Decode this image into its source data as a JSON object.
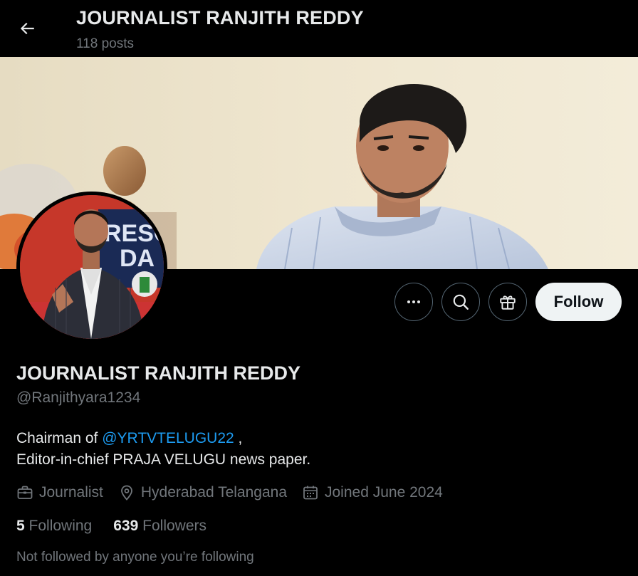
{
  "header": {
    "title": "JOURNALIST RANJITH REDDY",
    "posts_count": "118 posts"
  },
  "actions": {
    "follow_label": "Follow"
  },
  "profile": {
    "display_name": "JOURNALIST RANJITH REDDY",
    "handle": "@Ranjithyara1234",
    "bio_line1_prefix": "Chairman of ",
    "bio_mention": "@YRTVTELUGU22",
    "bio_line1_suffix": " ,",
    "bio_line2": "Editor-in-chief PRAJA VELUGU news paper.",
    "category": "Journalist",
    "location": "Hyderabad Telangana",
    "joined": "Joined June 2024",
    "following_count": "5",
    "following_label": "Following",
    "followers_count": "639",
    "followers_label": "Followers",
    "not_followed_text": "Not followed by anyone you’re following"
  },
  "banner_text": {
    "line1": "RESC",
    "line2": "DA"
  },
  "colors": {
    "background": "#000000",
    "text_primary": "#e7e9ea",
    "text_secondary": "#71767b",
    "link": "#1d9bf0",
    "button_light": "#eff3f4",
    "border": "#536471"
  },
  "icons": {
    "back": "arrow-left-icon",
    "more": "more-dots-icon",
    "search": "search-icon",
    "gift": "gift-icon",
    "category": "briefcase-icon",
    "location": "location-pin-icon",
    "joined": "calendar-icon"
  }
}
